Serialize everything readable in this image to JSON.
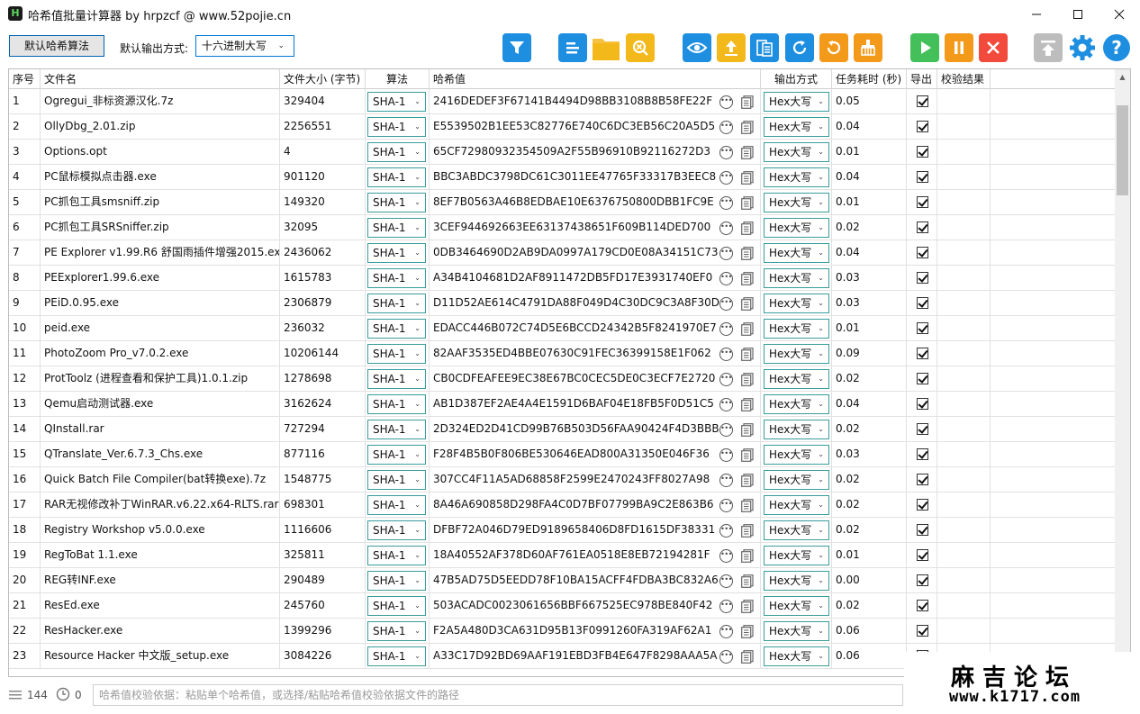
{
  "window": {
    "title": "哈希值批量计算器 by hrpzcf @ www.52pojie.cn",
    "app_icon_letter": "H"
  },
  "toolbar": {
    "default_algo_button": "默认哈希算法",
    "output_label": "默认输出方式:",
    "output_value": "十六进制大写",
    "icons": [
      "filter-icon",
      "list-icon",
      "folder-icon",
      "search-x-icon",
      "eye-icon",
      "upload-icon",
      "document-list-icon",
      "refresh-icon",
      "reload-icon",
      "clear-icon",
      "play-icon",
      "pause-icon",
      "stop-icon",
      "export-top-icon",
      "settings-icon",
      "help-icon"
    ]
  },
  "table": {
    "headers": [
      "序号",
      "文件名",
      "文件大小 (字节)",
      "算法",
      "哈希值",
      "输出方式",
      "任务耗时 (秒)",
      "导出",
      "校验结果"
    ],
    "rows": [
      {
        "no": "1",
        "name": "Ogregui_非标资源汉化.7z",
        "size": "329404",
        "algo": "SHA-1",
        "hash": "2416DEDEF3F67141B4494D98BB3108B8B58FE22F",
        "output": "Hex大写",
        "time": "0.05"
      },
      {
        "no": "2",
        "name": "OllyDbg_2.01.zip",
        "size": "2256551",
        "algo": "SHA-1",
        "hash": "E5539502B1EE53C82776E740C6DC3EB56C20A5D5",
        "output": "Hex大写",
        "time": "0.04"
      },
      {
        "no": "3",
        "name": "Options.opt",
        "size": "4",
        "algo": "SHA-1",
        "hash": "65CF72980932354509A2F55B96910B92116272D3",
        "output": "Hex大写",
        "time": "0.01"
      },
      {
        "no": "4",
        "name": "PC鼠标模拟点击器.exe",
        "size": "901120",
        "algo": "SHA-1",
        "hash": "BBC3ABDC3798DC61C3011EE47765F33317B3EEC8",
        "output": "Hex大写",
        "time": "0.04"
      },
      {
        "no": "5",
        "name": "PC抓包工具smsniff.zip",
        "size": "149320",
        "algo": "SHA-1",
        "hash": "8EF7B0563A46B8EDBAE10E6376750800DBB1FC9E",
        "output": "Hex大写",
        "time": "0.01"
      },
      {
        "no": "6",
        "name": "PC抓包工具SRSniffer.zip",
        "size": "32095",
        "algo": "SHA-1",
        "hash": "3CEF944692663EE63137438651F609B114DED700",
        "output": "Hex大写",
        "time": "0.02"
      },
      {
        "no": "7",
        "name": "PE Explorer v1.99.R6 舒国雨插件增强2015.exe",
        "size": "2436062",
        "algo": "SHA-1",
        "hash": "0DB3464690D2AB9DA0997A179CD0E08A34151C73",
        "output": "Hex大写",
        "time": "0.04"
      },
      {
        "no": "8",
        "name": "PEExplorer1.99.6.exe",
        "size": "1615783",
        "algo": "SHA-1",
        "hash": "A34B4104681D2AF8911472DB5FD17E3931740EF0",
        "output": "Hex大写",
        "time": "0.03"
      },
      {
        "no": "9",
        "name": "PEiD.0.95.exe",
        "size": "2306879",
        "algo": "SHA-1",
        "hash": "D11D52AE614C4791DA88F049D4C30DC9C3A8F30D",
        "output": "Hex大写",
        "time": "0.03"
      },
      {
        "no": "10",
        "name": "peid.exe",
        "size": "236032",
        "algo": "SHA-1",
        "hash": "EDACC446B072C74D5E6BCCD24342B5F8241970E7",
        "output": "Hex大写",
        "time": "0.01"
      },
      {
        "no": "11",
        "name": "PhotoZoom Pro_v7.0.2.exe",
        "size": "10206144",
        "algo": "SHA-1",
        "hash": "82AAF3535ED4BBE07630C91FEC36399158E1F062",
        "output": "Hex大写",
        "time": "0.09"
      },
      {
        "no": "12",
        "name": "ProtToolz (进程查看和保护工具)1.0.1.zip",
        "size": "1278698",
        "algo": "SHA-1",
        "hash": "CB0CDFEAFEE9EC38E67BC0CEC5DE0C3ECF7E2720",
        "output": "Hex大写",
        "time": "0.02"
      },
      {
        "no": "13",
        "name": "Qemu启动测试器.exe",
        "size": "3162624",
        "algo": "SHA-1",
        "hash": "AB1D387EF2AE4A4E1591D6BAF04E18FB5F0D51C5",
        "output": "Hex大写",
        "time": "0.04"
      },
      {
        "no": "14",
        "name": "QInstall.rar",
        "size": "727294",
        "algo": "SHA-1",
        "hash": "2D324ED2D41CD99B76B503D56FAA90424F4D3BBB",
        "output": "Hex大写",
        "time": "0.02"
      },
      {
        "no": "15",
        "name": "QTranslate_Ver.6.7.3_Chs.exe",
        "size": "877116",
        "algo": "SHA-1",
        "hash": "F28F4B5B0F806BE530646EAD800A31350E046F36",
        "output": "Hex大写",
        "time": "0.03"
      },
      {
        "no": "16",
        "name": "Quick Batch File Compiler(bat转换exe).7z",
        "size": "1548775",
        "algo": "SHA-1",
        "hash": "307CC4F11A5AD68858F2599E2470243FF8027A98",
        "output": "Hex大写",
        "time": "0.02"
      },
      {
        "no": "17",
        "name": "RAR无视修改补丁WinRAR.v6.22.x64-RLTS.rar",
        "size": "698301",
        "algo": "SHA-1",
        "hash": "8A46A690858D298FA4C0D7BF07799BA9C2E863B6",
        "output": "Hex大写",
        "time": "0.02"
      },
      {
        "no": "18",
        "name": "Registry Workshop v5.0.0.exe",
        "size": "1116606",
        "algo": "SHA-1",
        "hash": "DFBF72A046D79ED9189658406D8FD1615DF38331",
        "output": "Hex大写",
        "time": "0.02"
      },
      {
        "no": "19",
        "name": "RegToBat 1.1.exe",
        "size": "325811",
        "algo": "SHA-1",
        "hash": "18A40552AF378D60AF761EA0518E8EB72194281F",
        "output": "Hex大写",
        "time": "0.01"
      },
      {
        "no": "20",
        "name": "REG转INF.exe",
        "size": "290489",
        "algo": "SHA-1",
        "hash": "47B5AD75D5EEDD78F10BA15ACFF4FDBA3BC832A6",
        "output": "Hex大写",
        "time": "0.00"
      },
      {
        "no": "21",
        "name": "ResEd.exe",
        "size": "245760",
        "algo": "SHA-1",
        "hash": "503ACADC0023061656BBF667525EC978BE840F42",
        "output": "Hex大写",
        "time": "0.02"
      },
      {
        "no": "22",
        "name": "ResHacker.exe",
        "size": "1399296",
        "algo": "SHA-1",
        "hash": "F2A5A480D3CA631D95B13F0991260FA319AF62A1",
        "output": "Hex大写",
        "time": "0.06"
      },
      {
        "no": "23",
        "name": "Resource Hacker 中文版_setup.exe",
        "size": "3084226",
        "algo": "SHA-1",
        "hash": "A33C17D92BD69AAF191EBD3FB4E647F8298AAA5A",
        "output": "Hex大写",
        "time": "0.06"
      }
    ]
  },
  "statusbar": {
    "file_count": "144",
    "elapsed": "0",
    "verify_placeholder": "哈希值校验依据：粘贴单个哈希值，或选择/粘贴哈希值校验依据文件的路径"
  },
  "watermark": {
    "title": "麻吉论坛",
    "url": "www.k1717.com"
  },
  "colors": {
    "blue": "#1e8fe0",
    "amber": "#f3b81a",
    "green": "#43c05a",
    "orange": "#f39a1a",
    "red": "#f24a3d",
    "grey": "#bdbdbd"
  }
}
